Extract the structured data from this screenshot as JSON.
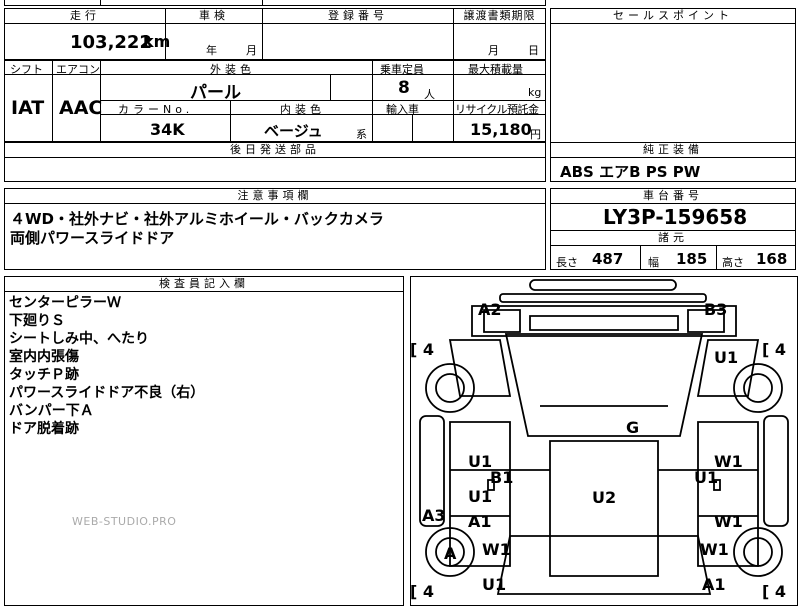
{
  "top_strip": {
    "left_text": "車検",
    "center_text": ""
  },
  "mileage": {
    "header": "走行",
    "value": "103,222",
    "unit": "km"
  },
  "inspection": {
    "header": "車検",
    "year": "年",
    "month": "月"
  },
  "registration": {
    "header": "登録番号",
    "value": ""
  },
  "transfer_deadline": {
    "header": "譲渡書類期限",
    "month": "月",
    "day": "日"
  },
  "sales_point": {
    "header": "セールスポイント"
  },
  "shift": {
    "header": "シフト",
    "value": "IAT"
  },
  "aircon": {
    "header": "エアコン",
    "value": "AAC"
  },
  "exterior_color": {
    "header": "外装色",
    "value": "パール"
  },
  "capacity": {
    "header": "乗車定員",
    "value": "8",
    "unit": "人"
  },
  "max_load": {
    "header": "最大積載量",
    "unit": "kg"
  },
  "color_no": {
    "header": "カラーNo.",
    "value": "34K"
  },
  "interior_color": {
    "header": "内装色",
    "value": "ベージュ",
    "suffix": "系"
  },
  "import_car": {
    "header": "輸入車"
  },
  "recycle": {
    "header": "リサイクル預託金",
    "value": "15,180",
    "unit": "円"
  },
  "later_parts": {
    "header": "後日発送部品"
  },
  "equipment": {
    "header": "純正装備",
    "value": "ABS エアB PS PW"
  },
  "caution": {
    "header": "注意事項欄",
    "line1": "４WD・社外ナビ・社外アルミホイール・バックカメラ",
    "line2": "両側パワースライドドア"
  },
  "chassis": {
    "header": "車台番号",
    "value": "LY3P-159658"
  },
  "specs": {
    "header": "諸元",
    "length_label": "長さ",
    "length": "487",
    "width_label": "幅",
    "width": "185",
    "height_label": "高さ",
    "height": "168"
  },
  "inspector": {
    "header": "検査員記入欄",
    "notes": [
      "センターピラーＷ",
      "下廻りＳ",
      "シートしみ中、へたり",
      "室内内張傷",
      "タッチＰ跡",
      "パワースライドドア不良（右）",
      "バンパー下Ａ",
      "ドア脱着跡"
    ],
    "watermark": "WEB-STUDIO.PRO"
  },
  "diagram": {
    "tires": {
      "front_left": "[ 4",
      "front_right": "[ 4",
      "rear_left": "[ 4",
      "rear_right": "[ 4"
    },
    "marks": {
      "a2": "A2",
      "b3": "B3",
      "u1_fr": "U1",
      "g": "G",
      "u1_l1": "U1",
      "b1": "B1",
      "u1_l2": "U1",
      "a1_l": "A1",
      "a3": "A3",
      "a_wheel": "A",
      "w1_l": "W1",
      "u1_l3": "U1",
      "u2": "U2",
      "w1_r1": "W1",
      "u1_r": "U1",
      "w1_r2": "W1",
      "w1_r3": "W1",
      "a1_r": "A1"
    }
  }
}
